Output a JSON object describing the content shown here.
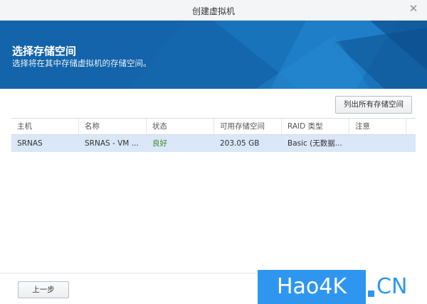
{
  "window": {
    "title": "创建虚拟机",
    "close_glyph": "✕"
  },
  "banner": {
    "heading": "选择存储空间",
    "subheading": "选择将在其中存储虚拟机的存储空间。",
    "color": "#1467ad"
  },
  "toolbar": {
    "list_all_label": "列出所有存储空间"
  },
  "grid": {
    "columns": [
      "主机",
      "名称",
      "状态",
      "可用存储空间",
      "RAID 类型",
      "注意"
    ],
    "rows": [
      {
        "host": "SRNAS",
        "name": "SRNAS - VM ...",
        "status": "良好",
        "free_space": "203.05 GB",
        "raid_type": "Basic (无数据...",
        "note": ""
      }
    ],
    "selected_row_color": "#d9e7f7",
    "status_good_color": "#3a8a1d"
  },
  "footer": {
    "prev_label": "上一步"
  },
  "watermark": {
    "main": "Hao4K",
    "suffix": "CN",
    "color": "#2f96f0"
  }
}
